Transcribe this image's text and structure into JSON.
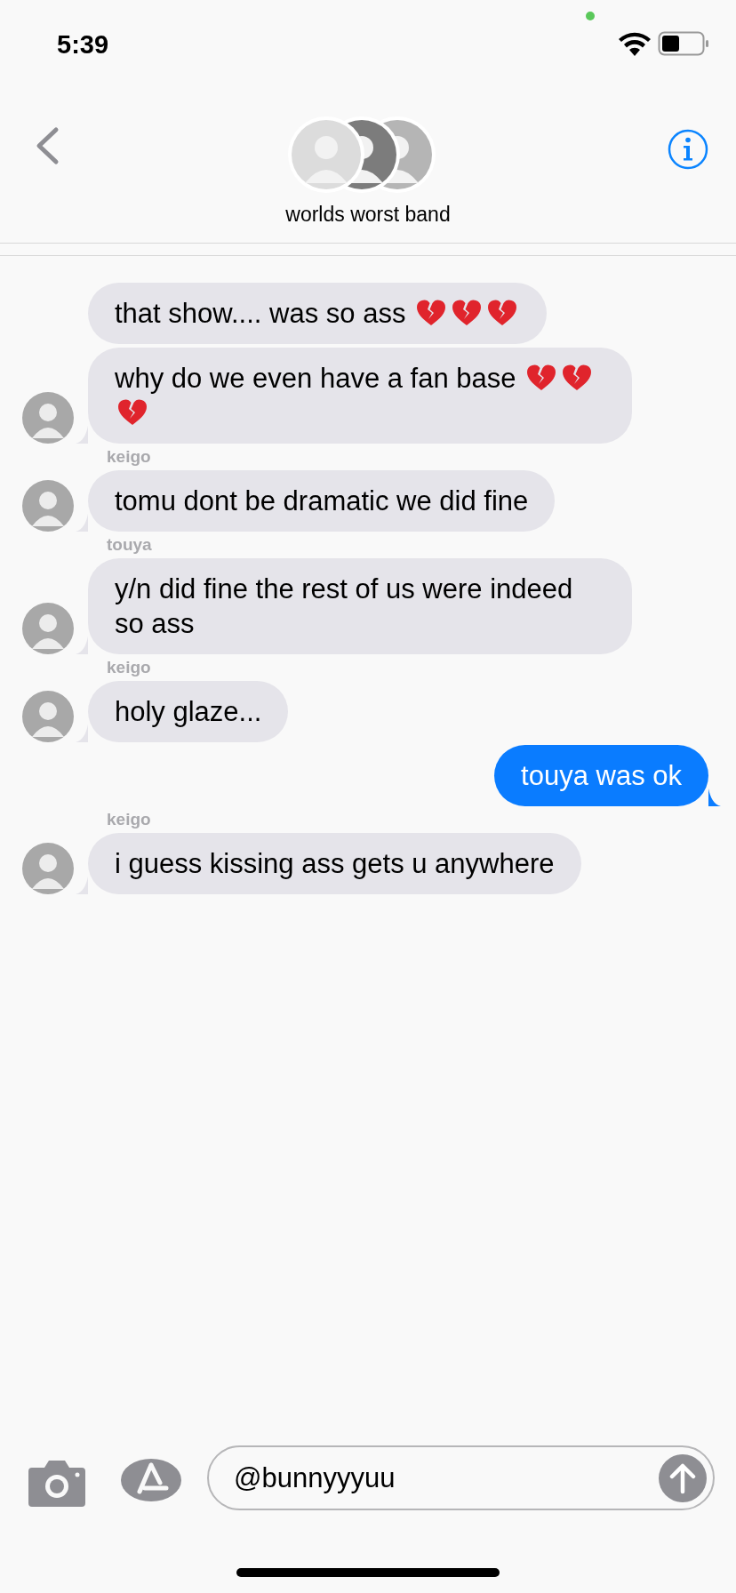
{
  "status_bar": {
    "time": "5:39",
    "camera_in_use": true
  },
  "header": {
    "title": "worlds worst band"
  },
  "groups": [
    {
      "kind": "incoming",
      "messages": [
        {
          "parts": [
            {
              "kind": "text",
              "text": "that show.... was so ass"
            },
            {
              "kind": "emoji"
            },
            {
              "kind": "emoji"
            },
            {
              "kind": "emoji"
            }
          ]
        },
        {
          "parts": [
            {
              "kind": "text",
              "text": "why do we even have a fan base"
            },
            {
              "kind": "emoji"
            },
            {
              "kind": "emoji"
            },
            {
              "kind": "emoji"
            }
          ]
        }
      ]
    },
    {
      "kind": "incoming",
      "sender": "keigo",
      "messages": [
        {
          "parts": [
            {
              "kind": "text",
              "text": "tomu dont be dramatic we did fine"
            }
          ]
        }
      ]
    },
    {
      "kind": "incoming",
      "sender": "touya",
      "messages": [
        {
          "parts": [
            {
              "kind": "text",
              "text": "y/n did fine the rest of us were indeed so ass"
            }
          ]
        }
      ]
    },
    {
      "kind": "incoming",
      "sender": "keigo",
      "messages": [
        {
          "parts": [
            {
              "kind": "text",
              "text": "holy glaze..."
            }
          ]
        }
      ]
    },
    {
      "kind": "outgoing",
      "messages": [
        {
          "parts": [
            {
              "kind": "text",
              "text": "touya was ok"
            }
          ]
        }
      ]
    },
    {
      "kind": "incoming",
      "sender": "keigo",
      "messages": [
        {
          "parts": [
            {
              "kind": "text",
              "text": "i guess kissing ass gets u anywhere"
            }
          ]
        }
      ]
    }
  ],
  "composer": {
    "value": "@bunnyyyuu"
  }
}
